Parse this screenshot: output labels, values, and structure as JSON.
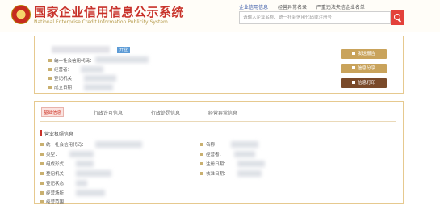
{
  "header": {
    "title": "国家企业信用信息公示系统",
    "subtitle": "National Enterprise Credit Information Publicity System",
    "links": [
      "企业信用信息",
      "经营异常名录",
      "严重违法失信企业名单"
    ],
    "search_placeholder": "请输入企业名称、统一社会信用代码或注册号"
  },
  "summary": {
    "badge": "开业",
    "fields": [
      "统一社会信用代码：",
      "经营者：",
      "登记机关：",
      "成立日期："
    ],
    "actions": [
      "发送报告",
      "信息分享",
      "信息打印"
    ]
  },
  "tabs": [
    "基础信息",
    "行政许可信息",
    "行政处罚信息",
    "经营异常信息"
  ],
  "section": {
    "title": "营业执照信息",
    "left_fields": [
      "统一社会信用代码：",
      "类型：",
      "组成形式：",
      "登记机关：",
      "登记状态：",
      "经营场所：",
      "经营范围："
    ],
    "right_fields": [
      "名称：",
      "经营者：",
      "注册日期：",
      "核准日期："
    ]
  },
  "colors": {
    "brand_red": "#c8322a",
    "gold": "#c9a35b",
    "brown": "#7a4a2a",
    "badge_blue": "#5c9bd6"
  }
}
